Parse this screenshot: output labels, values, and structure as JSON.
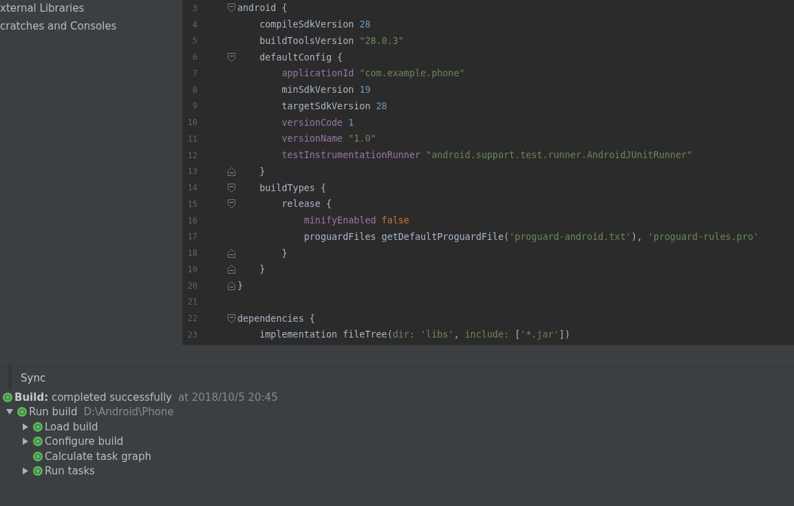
{
  "project_tree": {
    "items": [
      {
        "label": "xternal Libraries"
      },
      {
        "label": "cratches and Consoles"
      }
    ]
  },
  "editor": {
    "lines": [
      {
        "number": "3",
        "fold_start": true,
        "fold_end": false,
        "tokens": [
          {
            "text": "android {",
            "kind": "plain"
          }
        ]
      },
      {
        "number": "4",
        "fold_start": false,
        "fold_end": false,
        "tokens": [
          {
            "text": "    compileSdkVersion ",
            "kind": "plain"
          },
          {
            "text": "28",
            "kind": "number"
          }
        ]
      },
      {
        "number": "5",
        "fold_start": false,
        "fold_end": false,
        "tokens": [
          {
            "text": "    buildToolsVersion ",
            "kind": "plain"
          },
          {
            "text": "\"28.0.3\"",
            "kind": "string"
          }
        ]
      },
      {
        "number": "6",
        "fold_start": true,
        "fold_end": false,
        "tokens": [
          {
            "text": "    defaultConfig {",
            "kind": "plain"
          }
        ]
      },
      {
        "number": "7",
        "fold_start": false,
        "fold_end": false,
        "tokens": [
          {
            "text": "        applicationId ",
            "kind": "property"
          },
          {
            "text": "\"com.example.phone\"",
            "kind": "string"
          }
        ]
      },
      {
        "number": "8",
        "fold_start": false,
        "fold_end": false,
        "tokens": [
          {
            "text": "        minSdkVersion ",
            "kind": "plain"
          },
          {
            "text": "19",
            "kind": "number"
          }
        ]
      },
      {
        "number": "9",
        "fold_start": false,
        "fold_end": false,
        "tokens": [
          {
            "text": "        targetSdkVersion ",
            "kind": "plain"
          },
          {
            "text": "28",
            "kind": "number"
          }
        ]
      },
      {
        "number": "10",
        "fold_start": false,
        "fold_end": false,
        "tokens": [
          {
            "text": "        versionCode ",
            "kind": "property"
          },
          {
            "text": "1",
            "kind": "number"
          }
        ]
      },
      {
        "number": "11",
        "fold_start": false,
        "fold_end": false,
        "tokens": [
          {
            "text": "        versionName ",
            "kind": "property"
          },
          {
            "text": "\"1.0\"",
            "kind": "string"
          }
        ]
      },
      {
        "number": "12",
        "fold_start": false,
        "fold_end": false,
        "tokens": [
          {
            "text": "        testInstrumentationRunner ",
            "kind": "property"
          },
          {
            "text": "\"android.support.test.runner.AndroidJUnitRunner\"",
            "kind": "string"
          }
        ]
      },
      {
        "number": "13",
        "fold_start": false,
        "fold_end": true,
        "tokens": [
          {
            "text": "    }",
            "kind": "plain"
          }
        ]
      },
      {
        "number": "14",
        "fold_start": true,
        "fold_end": false,
        "tokens": [
          {
            "text": "    buildTypes {",
            "kind": "plain"
          }
        ]
      },
      {
        "number": "15",
        "fold_start": true,
        "fold_end": false,
        "tokens": [
          {
            "text": "        release {",
            "kind": "plain"
          }
        ]
      },
      {
        "number": "16",
        "fold_start": false,
        "fold_end": false,
        "tokens": [
          {
            "text": "            minifyEnabled ",
            "kind": "property"
          },
          {
            "text": "false",
            "kind": "keyword"
          }
        ]
      },
      {
        "number": "17",
        "fold_start": false,
        "fold_end": false,
        "tokens": [
          {
            "text": "            proguardFiles getDefaultProguardFile(",
            "kind": "plain"
          },
          {
            "text": "'proguard-android.txt'",
            "kind": "string"
          },
          {
            "text": "), ",
            "kind": "plain"
          },
          {
            "text": "'proguard-rules.pro'",
            "kind": "string"
          }
        ]
      },
      {
        "number": "18",
        "fold_start": false,
        "fold_end": true,
        "tokens": [
          {
            "text": "        }",
            "kind": "plain"
          }
        ]
      },
      {
        "number": "19",
        "fold_start": false,
        "fold_end": true,
        "tokens": [
          {
            "text": "    }",
            "kind": "plain"
          }
        ]
      },
      {
        "number": "20",
        "fold_start": false,
        "fold_end": true,
        "tokens": [
          {
            "text": "}",
            "kind": "plain"
          }
        ]
      },
      {
        "number": "21",
        "fold_start": false,
        "fold_end": false
      },
      {
        "number": "22",
        "fold_start": true,
        "fold_end": false,
        "tokens": [
          {
            "text": "dependencies {",
            "kind": "plain"
          }
        ]
      },
      {
        "number": "23",
        "fold_start": false,
        "fold_end": false,
        "tokens": [
          {
            "text": "    implementation fileTree(",
            "kind": "plain"
          },
          {
            "text": "dir: 'libs'",
            "kind": "string"
          },
          {
            "text": ", ",
            "kind": "plain"
          },
          {
            "text": "include: ",
            "kind": "string"
          },
          {
            "text": "[",
            "kind": "plain"
          },
          {
            "text": "'*.jar'",
            "kind": "string"
          },
          {
            "text": "])",
            "kind": "plain"
          }
        ]
      }
    ]
  },
  "build_panel": {
    "tab": {
      "label": "Sync",
      "selected": true
    },
    "tree": [
      {
        "succeeded": true,
        "label": "**Build:** completed successfully",
        "detail": "at 2018/10/5 20:45"
      },
      {
        "succeeded": true,
        "label": "Run build",
        "detail": "D:\\Android\\Phone",
        "expanded": true,
        "children": [
          {
            "succeeded": true,
            "label": "Load build",
            "expanded": false
          },
          {
            "succeeded": true,
            "label": "Configure build",
            "expanded": false
          },
          {
            "succeeded": true,
            "label": "Calculate task graph"
          },
          {
            "succeeded": true,
            "label": "Run tasks",
            "expanded": false
          }
        ]
      }
    ]
  }
}
